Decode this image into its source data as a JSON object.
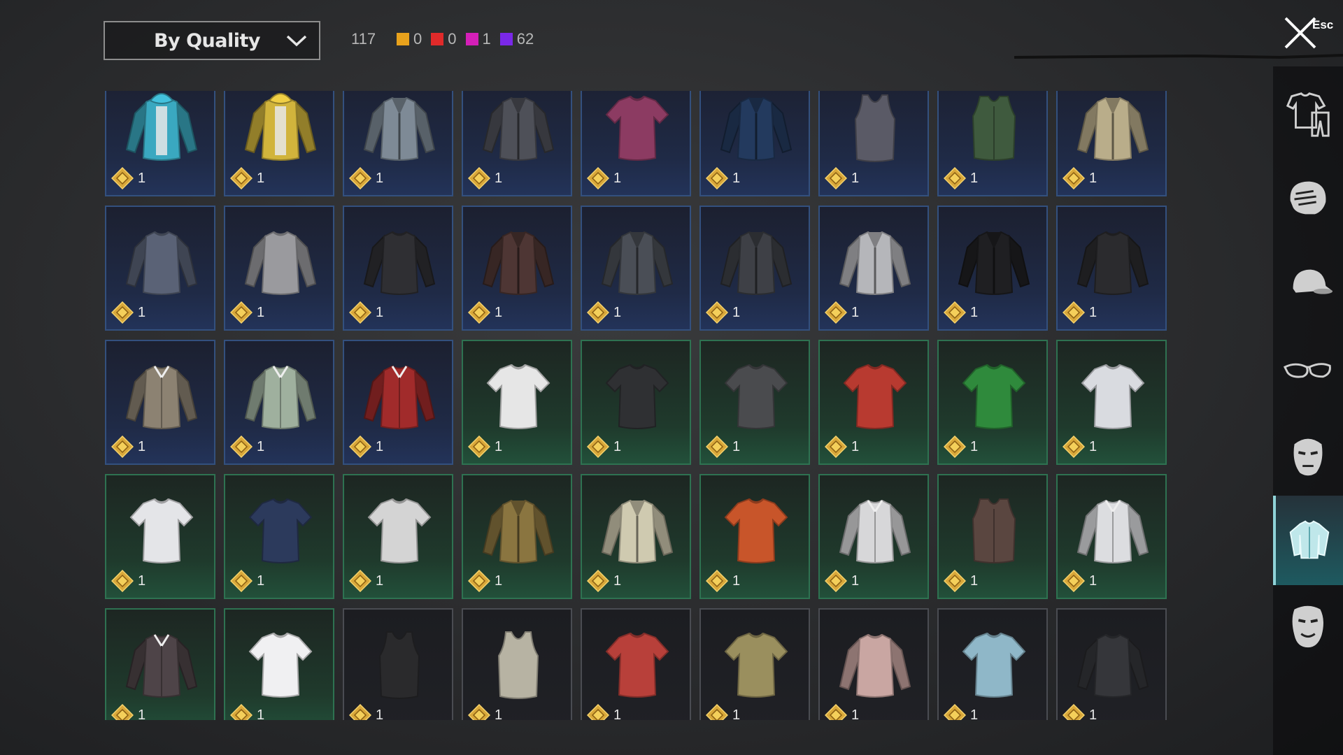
{
  "filter": {
    "sort_label": "By Quality"
  },
  "summary": {
    "total": "117",
    "quality_counts": [
      {
        "color": "#e8a21c",
        "count": "0"
      },
      {
        "color": "#e12a2a",
        "count": "0"
      },
      {
        "color": "#d41fb8",
        "count": "1"
      },
      {
        "color": "#7a28e8",
        "count": "62"
      }
    ]
  },
  "close": {
    "esc_label": "Esc"
  },
  "sidebar": {
    "categories": [
      {
        "name": "outfits",
        "icon": "shirt-pants-icon"
      },
      {
        "name": "hair",
        "icon": "head-hair-icon"
      },
      {
        "name": "hats",
        "icon": "cap-icon"
      },
      {
        "name": "glasses",
        "icon": "glasses-icon"
      },
      {
        "name": "masks",
        "icon": "mask-icon"
      },
      {
        "name": "tops",
        "icon": "jacket-icon",
        "active": true
      },
      {
        "name": "faces",
        "icon": "face-icon"
      }
    ]
  },
  "inventory": {
    "items": [
      {
        "rarity": "blue",
        "icon": "hoodie-icon",
        "color": "#3aa8c0",
        "qty": "1"
      },
      {
        "rarity": "blue",
        "icon": "hoodie-icon",
        "color": "#d1b43c",
        "qty": "1"
      },
      {
        "rarity": "blue",
        "icon": "jacket-icon",
        "color": "#7e8a96",
        "qty": "1"
      },
      {
        "rarity": "blue",
        "icon": "jacket-icon",
        "color": "#4e5058",
        "qty": "1"
      },
      {
        "rarity": "blue",
        "icon": "tshirt-icon",
        "color": "#8c3b62",
        "qty": "1"
      },
      {
        "rarity": "blue",
        "icon": "jacket-icon",
        "color": "#233a5e",
        "qty": "1"
      },
      {
        "rarity": "blue",
        "icon": "tanktop-icon",
        "color": "#5a5a66",
        "qty": "1"
      },
      {
        "rarity": "blue",
        "icon": "vest-icon",
        "color": "#3f5a3e",
        "qty": "1"
      },
      {
        "rarity": "blue",
        "icon": "jacket-icon",
        "color": "#b9ad8a",
        "qty": "1"
      },
      {
        "rarity": "blue",
        "icon": "longsleeve-icon",
        "color": "#5a6276",
        "qty": "1"
      },
      {
        "rarity": "blue",
        "icon": "longsleeve-icon",
        "color": "#9a9a9e",
        "qty": "1"
      },
      {
        "rarity": "blue",
        "icon": "longsleeve-icon",
        "color": "#2f2f33",
        "qty": "1"
      },
      {
        "rarity": "blue",
        "icon": "jacket-icon",
        "color": "#4e3634",
        "qty": "1"
      },
      {
        "rarity": "blue",
        "icon": "jacket-icon",
        "color": "#4a4e56",
        "qty": "1"
      },
      {
        "rarity": "blue",
        "icon": "jacket-icon",
        "color": "#3e4046",
        "qty": "1"
      },
      {
        "rarity": "blue",
        "icon": "jacket-icon",
        "color": "#b5b6ba",
        "qty": "1"
      },
      {
        "rarity": "blue",
        "icon": "jacket-icon",
        "color": "#1f1f22",
        "qty": "1"
      },
      {
        "rarity": "blue",
        "icon": "longsleeve-icon",
        "color": "#2b2b2e",
        "qty": "1"
      },
      {
        "rarity": "blue",
        "icon": "shirt-icon",
        "color": "#8c8272",
        "qty": "1"
      },
      {
        "rarity": "blue",
        "icon": "shirt-icon",
        "color": "#9fb09e",
        "qty": "1"
      },
      {
        "rarity": "blue",
        "icon": "shirt-icon",
        "color": "#a12b2b",
        "qty": "1"
      },
      {
        "rarity": "green",
        "icon": "tshirt-icon",
        "color": "#e6e6e6",
        "qty": "1"
      },
      {
        "rarity": "green",
        "icon": "tshirt-icon",
        "color": "#2f3033",
        "qty": "1"
      },
      {
        "rarity": "green",
        "icon": "tshirt-icon",
        "color": "#4a4b4e",
        "qty": "1"
      },
      {
        "rarity": "green",
        "icon": "tshirt-icon",
        "color": "#b83a30",
        "qty": "1"
      },
      {
        "rarity": "green",
        "icon": "tshirt-icon",
        "color": "#2f8a3c",
        "qty": "1"
      },
      {
        "rarity": "green",
        "icon": "tshirt-icon",
        "color": "#d9dbe0",
        "qty": "1"
      },
      {
        "rarity": "green",
        "icon": "tshirt-icon",
        "color": "#e4e5e8",
        "qty": "1"
      },
      {
        "rarity": "green",
        "icon": "tshirt-icon",
        "color": "#2c3a5c",
        "qty": "1"
      },
      {
        "rarity": "green",
        "icon": "tshirt-icon",
        "color": "#d4d4d4",
        "qty": "1"
      },
      {
        "rarity": "green",
        "icon": "jacket-icon",
        "color": "#8a7540",
        "qty": "1"
      },
      {
        "rarity": "green",
        "icon": "jacket-icon",
        "color": "#cfcab0",
        "qty": "1"
      },
      {
        "rarity": "green",
        "icon": "tshirt-icon",
        "color": "#c8552a",
        "qty": "1"
      },
      {
        "rarity": "green",
        "icon": "shirt-icon",
        "color": "#d7d7d9",
        "qty": "1"
      },
      {
        "rarity": "green",
        "icon": "vest-icon",
        "color": "#5a4640",
        "qty": "1"
      },
      {
        "rarity": "green",
        "icon": "shirt-icon",
        "color": "#dcdde0",
        "qty": "1"
      },
      {
        "rarity": "green",
        "icon": "shirt-icon",
        "color": "#4e4448",
        "qty": "1"
      },
      {
        "rarity": "green",
        "icon": "tshirt-icon",
        "color": "#f0f0f2",
        "qty": "1"
      },
      {
        "rarity": "gray",
        "icon": "tanktop-icon",
        "color": "#2a2a2c",
        "qty": "1"
      },
      {
        "rarity": "gray",
        "icon": "tanktop-icon",
        "color": "#b7b3a3",
        "qty": "1"
      },
      {
        "rarity": "gray",
        "icon": "tshirt-icon",
        "color": "#b8403a",
        "qty": "1"
      },
      {
        "rarity": "gray",
        "icon": "tshirt-icon",
        "color": "#9a8f5e",
        "qty": "1"
      },
      {
        "rarity": "gray",
        "icon": "longsleeve-icon",
        "color": "#c9a6a2",
        "qty": "1"
      },
      {
        "rarity": "gray",
        "icon": "tshirt-icon",
        "color": "#8fb7c8",
        "qty": "1"
      },
      {
        "rarity": "gray",
        "icon": "longsleeve-icon",
        "color": "#35363a",
        "qty": "1"
      }
    ]
  }
}
